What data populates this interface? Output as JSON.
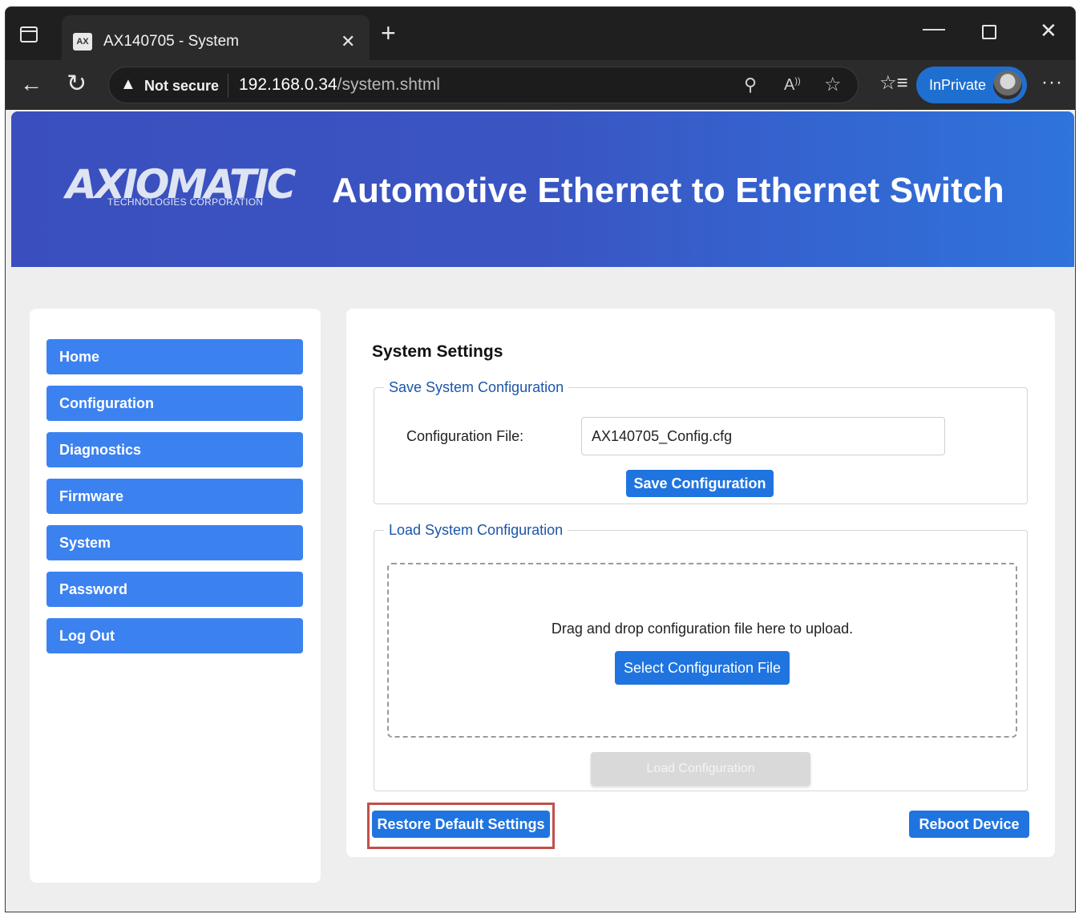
{
  "browser": {
    "tab_title": "AX140705 - System",
    "tab_favicon_text": "AX",
    "security_label": "Not secure",
    "url_host": "192.168.0.34",
    "url_path": "/system.shtml",
    "inprivate_label": "InPrivate"
  },
  "header": {
    "logo_text": "AXIOMATIC",
    "logo_subtext": "TECHNOLOGIES CORPORATION",
    "title": "Automotive Ethernet to Ethernet Switch"
  },
  "sidebar": {
    "items": [
      {
        "label": "Home"
      },
      {
        "label": "Configuration"
      },
      {
        "label": "Diagnostics"
      },
      {
        "label": "Firmware"
      },
      {
        "label": "System"
      },
      {
        "label": "Password"
      },
      {
        "label": "Log Out"
      }
    ]
  },
  "main": {
    "title": "System Settings",
    "save_group": {
      "legend": "Save System Configuration",
      "field_label": "Configuration File:",
      "field_value": "AX140705_Config.cfg",
      "button": "Save Configuration"
    },
    "load_group": {
      "legend": "Load System Configuration",
      "drop_text": "Drag and drop configuration file here to upload.",
      "select_button": "Select Configuration File",
      "load_button": "Load Configuration"
    },
    "restore_button": "Restore Default Settings",
    "reboot_button": "Reboot Device"
  }
}
